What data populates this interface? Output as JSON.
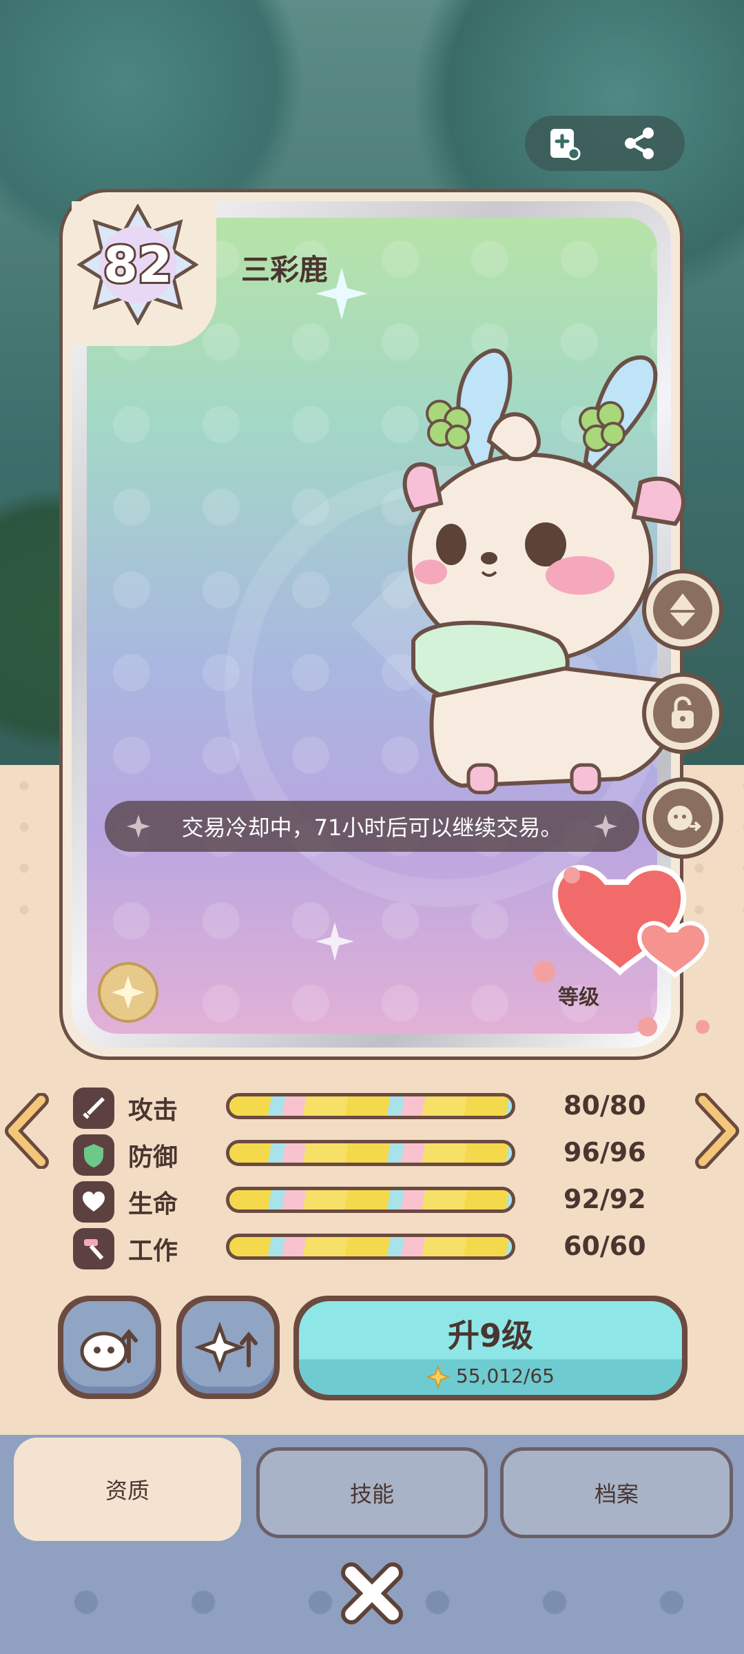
{
  "card": {
    "level": "82",
    "name": "三彩鹿",
    "notice": "交易冷却中，71小时后可以继续交易。",
    "level_label": "等级"
  },
  "stats": [
    {
      "label": "攻击",
      "value": "80/80",
      "fill": 1.0,
      "icon": "sword-icon"
    },
    {
      "label": "防御",
      "value": "96/96",
      "fill": 1.0,
      "icon": "shield-icon"
    },
    {
      "label": "生命",
      "value": "92/92",
      "fill": 1.0,
      "icon": "heart-icon"
    },
    {
      "label": "工作",
      "value": "60/60",
      "fill": 1.0,
      "icon": "hammer-icon"
    }
  ],
  "upgrade": {
    "title": "升9级",
    "cost": "55,012/65"
  },
  "tabs": [
    "资质",
    "技能",
    "档案"
  ],
  "colors": {
    "outline": "#6b5046",
    "upgrade_button": "#8fe6e6",
    "tab_panel": "#8fa0c0"
  }
}
